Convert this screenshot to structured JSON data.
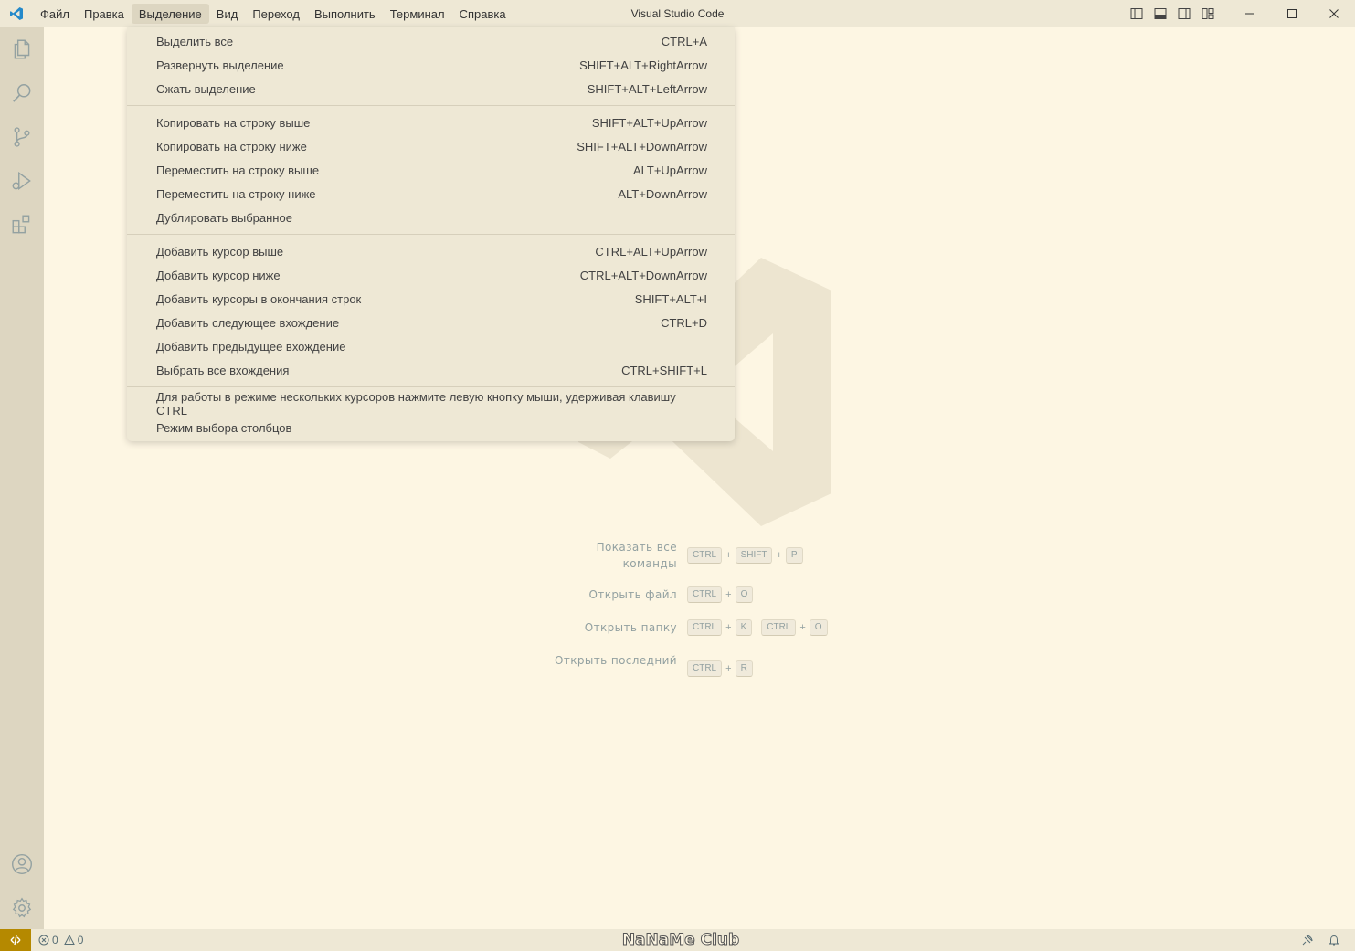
{
  "window": {
    "title": "Visual Studio Code"
  },
  "menubar": {
    "items": [
      {
        "label": "Файл"
      },
      {
        "label": "Правка"
      },
      {
        "label": "Выделение",
        "active": true
      },
      {
        "label": "Вид"
      },
      {
        "label": "Переход"
      },
      {
        "label": "Выполнить"
      },
      {
        "label": "Терминал"
      },
      {
        "label": "Справка"
      }
    ]
  },
  "activitybar": {
    "top_icons": [
      "files-icon",
      "search-icon",
      "source-control-icon",
      "run-debug-icon",
      "extensions-icon"
    ],
    "bottom_icons": [
      "account-icon",
      "settings-gear-icon"
    ]
  },
  "selection_menu": {
    "groups": [
      [
        {
          "label": "Выделить все",
          "shortcut": "CTRL+A"
        },
        {
          "label": "Развернуть выделение",
          "shortcut": "SHIFT+ALT+RightArrow"
        },
        {
          "label": "Сжать выделение",
          "shortcut": "SHIFT+ALT+LeftArrow"
        }
      ],
      [
        {
          "label": "Копировать на строку выше",
          "shortcut": "SHIFT+ALT+UpArrow"
        },
        {
          "label": "Копировать на строку ниже",
          "shortcut": "SHIFT+ALT+DownArrow"
        },
        {
          "label": "Переместить на строку выше",
          "shortcut": "ALT+UpArrow"
        },
        {
          "label": "Переместить на строку ниже",
          "shortcut": "ALT+DownArrow"
        },
        {
          "label": "Дублировать выбранное",
          "shortcut": ""
        }
      ],
      [
        {
          "label": "Добавить курсор выше",
          "shortcut": "CTRL+ALT+UpArrow"
        },
        {
          "label": "Добавить курсор ниже",
          "shortcut": "CTRL+ALT+DownArrow"
        },
        {
          "label": "Добавить курсоры в окончания строк",
          "shortcut": "SHIFT+ALT+I"
        },
        {
          "label": "Добавить следующее вхождение",
          "shortcut": "CTRL+D"
        },
        {
          "label": "Добавить предыдущее вхождение",
          "shortcut": ""
        },
        {
          "label": "Выбрать все вхождения",
          "shortcut": "CTRL+SHIFT+L"
        }
      ],
      [
        {
          "label": "Для работы в режиме нескольких курсоров нажмите левую кнопку мыши, удерживая клавишу CTRL",
          "shortcut": ""
        },
        {
          "label": "Режим выбора столбцов",
          "shortcut": ""
        }
      ]
    ]
  },
  "welcome_hints": [
    {
      "label": "Показать все команды",
      "keys": [
        [
          "CTRL",
          "SHIFT",
          "P"
        ]
      ]
    },
    {
      "label": "Открыть файл",
      "keys": [
        [
          "CTRL",
          "O"
        ]
      ]
    },
    {
      "label": "Открыть папку",
      "keys": [
        [
          "CTRL",
          "K"
        ],
        [
          "CTRL",
          "O"
        ]
      ]
    },
    {
      "label": "Открыть последний",
      "keys": [
        [
          "CTRL",
          "R"
        ]
      ]
    }
  ],
  "statusbar": {
    "errors": "0",
    "warnings": "0",
    "watermark_text": "NaNaMe Club"
  },
  "colors": {
    "editor_bg": "#fdf6e3",
    "activitybar_bg": "#ddd6c1",
    "titlebar_bg": "#eee8d5",
    "remote_accent": "#b58900"
  }
}
